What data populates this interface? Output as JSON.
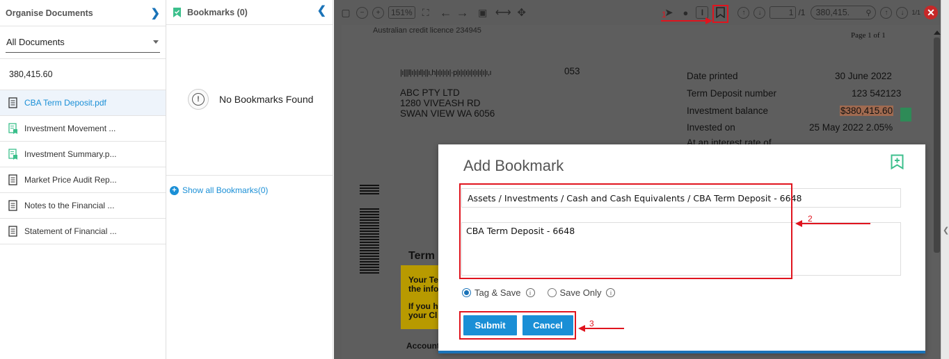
{
  "left_panel": {
    "header": "Organise Documents",
    "filter": "All Documents",
    "amount": "380,415.60",
    "documents": [
      {
        "label": "CBA Term Deposit.pdf",
        "icon": "document-icon",
        "active": true
      },
      {
        "label": "Investment Movement ...",
        "icon": "bookmarked-document-icon",
        "active": false
      },
      {
        "label": "Investment Summary.p...",
        "icon": "bookmarked-document-icon",
        "active": false
      },
      {
        "label": "Market Price Audit Rep...",
        "icon": "document-icon",
        "active": false
      },
      {
        "label": "Notes to the Financial ...",
        "icon": "document-icon",
        "active": false
      },
      {
        "label": "Statement of Financial ...",
        "icon": "document-icon",
        "active": false
      }
    ]
  },
  "bookmarks_panel": {
    "header": "Bookmarks (0)",
    "empty_message": "No Bookmarks Found",
    "show_all": "Show all Bookmarks(0)"
  },
  "toolbar": {
    "zoom": "151%",
    "page_current": "1",
    "page_total": "/1",
    "search_value": "380,415.",
    "page_mini": "1/1"
  },
  "document": {
    "top_text": "Australian credit licence 234945",
    "page_label": "Page 1 of 1",
    "barcode_text": "|ı|||l|ı|ı|ıl|ı||ı,h|ı|ı|ı|ı|·p|ı|ı|ı|ı|ı|ı|ı|ı|ı,ı",
    "code": "053",
    "address": [
      "ABC PTY LTD",
      "1280 VIVEASH RD",
      "SWAN VIEW WA 6056"
    ],
    "details": [
      {
        "label": "Date printed",
        "value": "30 June 2022"
      },
      {
        "label": "Term Deposit number",
        "value": "123  542123"
      },
      {
        "label": "Investment balance",
        "value": "$380,415.60"
      },
      {
        "label": "Invested on",
        "value": "25 May 2022 2.05%"
      }
    ],
    "cut_text": "At an interest rate of",
    "term_heading": "Term",
    "yellow_lines": [
      "Your Te",
      "the info",
      "If you h",
      "your Cl"
    ],
    "account_label": "Account"
  },
  "dialog": {
    "title": "Add Bookmark",
    "path_value": "Assets / Investments / Cash and Cash Equivalents / CBA Term Deposit - 6648",
    "name_value": "CBA Term Deposit - 6648",
    "radio_tag_save": "Tag & Save",
    "radio_save_only": "Save Only",
    "submit_label": "Submit",
    "cancel_label": "Cancel"
  },
  "annotations": {
    "step1": "1",
    "step2": "2",
    "step3": "3",
    "color": "#e0141e"
  },
  "colors": {
    "accent": "#1a8fd6",
    "bookmark_green": "#3cbf8c",
    "viewer_bg": "#5c5c5c"
  }
}
